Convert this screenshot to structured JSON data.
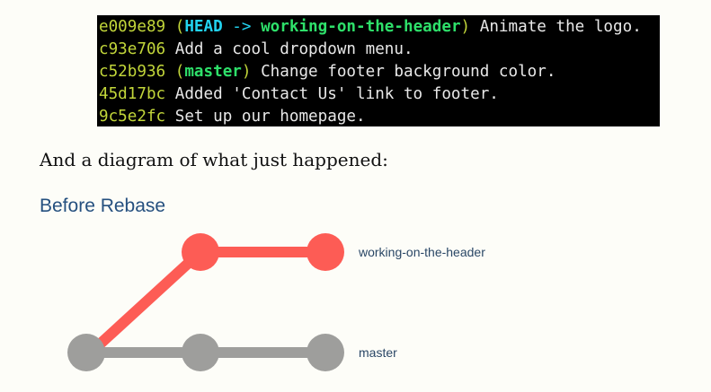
{
  "terminal": {
    "lines": [
      {
        "hash": "e009e89",
        "refs_open": "(",
        "head": "HEAD",
        "arrow": " -> ",
        "branch": "working-on-the-header",
        "refs_close": ")",
        "message": " Animate the logo."
      },
      {
        "hash": "c93e706",
        "message": " Add a cool dropdown menu."
      },
      {
        "hash": "c52b936",
        "refs_open": "(",
        "branch": "master",
        "refs_close": ")",
        "message": " Change footer background color."
      },
      {
        "hash": "45d17bc",
        "message": " Added 'Contact Us' link to footer."
      },
      {
        "hash": "9c5e2fc",
        "message": " Set up our homepage."
      }
    ]
  },
  "caption": "And a diagram of what just happened:",
  "diagram": {
    "title": "Before Rebase",
    "branches": {
      "feature_label": "working-on-the-header",
      "master_label": "master"
    },
    "colors": {
      "feature": "#fd5c55",
      "master": "#9e9e9c"
    }
  }
}
